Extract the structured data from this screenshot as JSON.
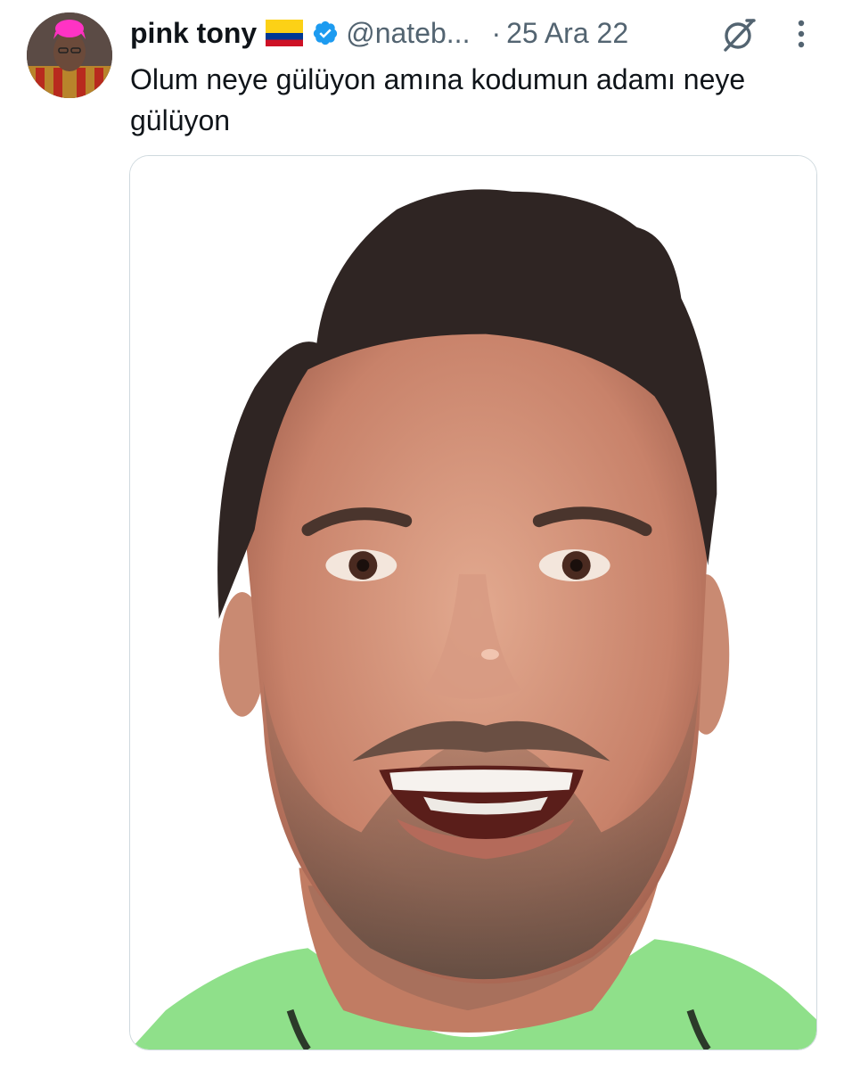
{
  "tweet": {
    "author": {
      "display_name": "pink tony",
      "flag_icon": "colombia-flag-icon",
      "verified_icon": "verified-badge-icon",
      "handle": "@nateb...",
      "avatar": "avatar"
    },
    "separator": "·",
    "date": "25 Ara 22",
    "text": "Olum neye gülüyon amına kodumun adamı neye gülüyon",
    "media": {
      "description": "photo-of-smiling-man"
    },
    "actions": {
      "grok_icon": "grok-icon",
      "more_icon": "more-vertical-icon"
    }
  },
  "colors": {
    "text_primary": "#0f1419",
    "text_secondary": "#536471",
    "verified_blue": "#1d9bf0",
    "border": "#cfd9de"
  }
}
